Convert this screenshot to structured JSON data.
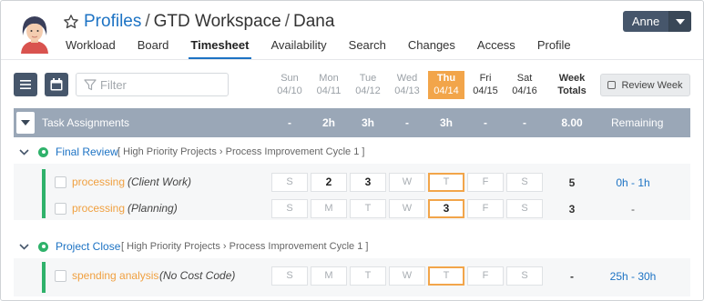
{
  "header": {
    "title_profiles": "Profiles",
    "sep1": "/",
    "title_workspace": "GTD Workspace",
    "sep2": "/",
    "title_user": "Dana"
  },
  "user_menu": {
    "label": "Anne"
  },
  "tabs": [
    "Workload",
    "Board",
    "Timesheet",
    "Availability",
    "Search",
    "Changes",
    "Access",
    "Profile"
  ],
  "active_tab": "Timesheet",
  "toolbar": {
    "filter_placeholder": "Filter",
    "review_label": "Review Week"
  },
  "days": [
    {
      "dow": "Sun",
      "date": "04/10"
    },
    {
      "dow": "Mon",
      "date": "04/11"
    },
    {
      "dow": "Tue",
      "date": "04/12"
    },
    {
      "dow": "Wed",
      "date": "04/13"
    },
    {
      "dow": "Thu",
      "date": "04/14"
    },
    {
      "dow": "Fri",
      "date": "04/15"
    },
    {
      "dow": "Sat",
      "date": "04/16"
    }
  ],
  "week_totals": {
    "line1": "Week",
    "line2": "Totals"
  },
  "assignments": {
    "title": "Task Assignments",
    "day_totals": [
      "-",
      "2h",
      "3h",
      "-",
      "3h",
      "-",
      "-"
    ],
    "week_total": "8.00",
    "remaining_label": "Remaining"
  },
  "groups": [
    {
      "name": "Final Review",
      "path_open": "[",
      "path_a": "High Priority Projects",
      "path_b": "Process Improvement Cycle 1",
      "path_close": "]",
      "tasks": [
        {
          "name": "processing",
          "code": "(Client Work)",
          "cells": [
            "S",
            "2",
            "3",
            "W",
            "T",
            "F",
            "S"
          ],
          "total": "5",
          "remaining": "0h - 1h"
        },
        {
          "name": "processing",
          "code": "(Planning)",
          "cells": [
            "S",
            "M",
            "T",
            "W",
            "3",
            "F",
            "S"
          ],
          "total": "3",
          "remaining": "-"
        }
      ]
    },
    {
      "name": "Project Close",
      "path_open": "[",
      "path_a": "High Priority Projects",
      "path_b": "Process Improvement Cycle 1",
      "path_close": "]",
      "tasks": [
        {
          "name": "spending analysis",
          "code": "(No Cost Code)",
          "cells": [
            "S",
            "M",
            "T",
            "W",
            "T",
            "F",
            "S"
          ],
          "total": "-",
          "remaining": "25h - 30h"
        }
      ]
    }
  ],
  "colors": {
    "accent": "#1d73c4",
    "today": "#f2a54a",
    "task_text": "#f0a040",
    "status_green": "#2fb26b",
    "header_bar": "#9aa7b7",
    "button_dark": "#46566b"
  },
  "icons": [
    "avatar",
    "star-icon",
    "chevron-down-icon",
    "list-icon",
    "calendar-icon",
    "filter-icon",
    "checkbox-icon",
    "status-dot-icon"
  ]
}
